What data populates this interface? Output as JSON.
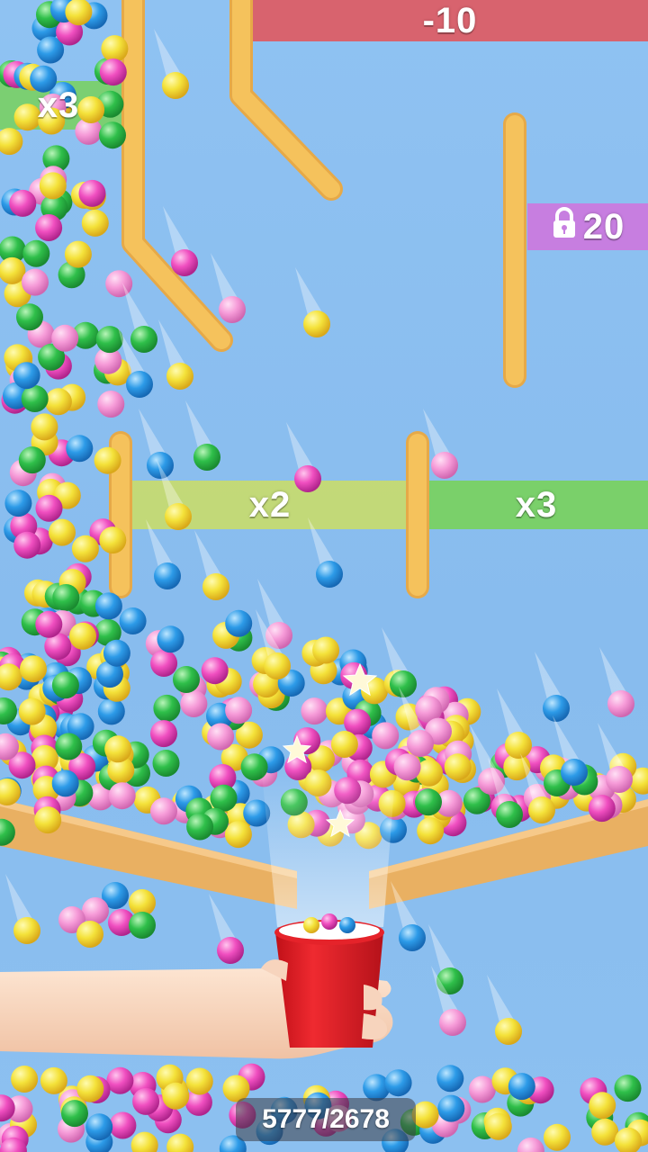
{
  "gates": {
    "top_penalty": "-10",
    "left_multiplier": "x3",
    "locked_value": "20",
    "middle_multiplier": "x2",
    "right_multiplier": "x3"
  },
  "icons": {
    "lock": "lock-icon",
    "cup": "cup-icon",
    "hand": "hand-icon",
    "star": "star-icon"
  },
  "counter": "5777/2678",
  "colors": {
    "background": "#8ec0f0",
    "wall": "#f5c25c",
    "penalty_gate": "#d8636e",
    "multiplier_gate": "#7ad06a",
    "x2_gate": "#c9dc6a",
    "locked_gate": "#c77ee0",
    "cup": "#e5232a",
    "ramp": "#e9b062",
    "ball_yellow": "#f4e23a",
    "ball_pink": "#f24fc0",
    "ball_blue": "#2d9be8",
    "ball_green": "#2fbf4a"
  }
}
